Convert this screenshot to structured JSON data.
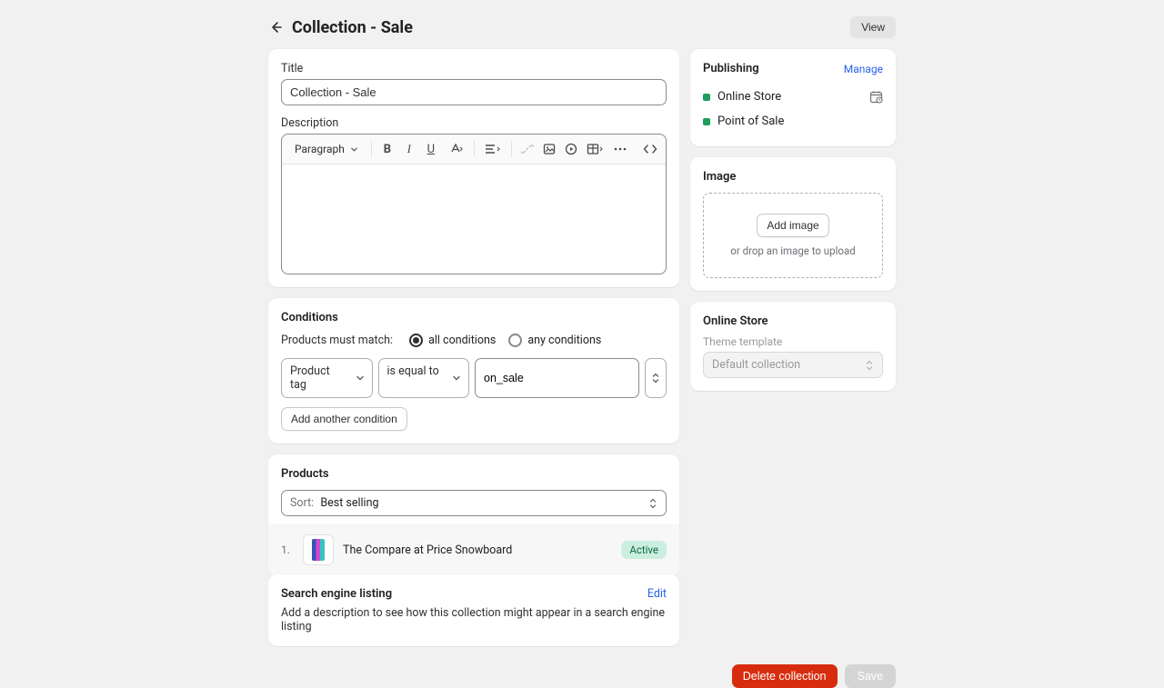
{
  "header": {
    "title": "Collection - Sale",
    "view_label": "View"
  },
  "title_section": {
    "label": "Title",
    "value": "Collection - Sale"
  },
  "description_section": {
    "label": "Description",
    "paragraph_label": "Paragraph"
  },
  "conditions": {
    "heading": "Conditions",
    "match_label": "Products must match:",
    "all_label": "all conditions",
    "any_label": "any conditions",
    "selected": "all",
    "field": "Product tag",
    "operator": "is equal to",
    "value": "on_sale",
    "add_label": "Add another condition"
  },
  "products": {
    "heading": "Products",
    "sort_prefix": "Sort:",
    "sort_value": "Best selling",
    "items": [
      {
        "index": "1.",
        "name": "The Compare at Price Snowboard",
        "status": "Active"
      }
    ]
  },
  "seo": {
    "heading": "Search engine listing",
    "edit_label": "Edit",
    "description": "Add a description to see how this collection might appear in a search engine listing"
  },
  "publishing": {
    "heading": "Publishing",
    "manage_label": "Manage",
    "channels": [
      {
        "name": "Online Store",
        "has_schedule": true
      },
      {
        "name": "Point of Sale",
        "has_schedule": false
      }
    ]
  },
  "image": {
    "heading": "Image",
    "add_label": "Add image",
    "hint": "or drop an image to upload"
  },
  "online_store": {
    "heading": "Online Store",
    "template_label": "Theme template",
    "template_value": "Default collection"
  },
  "footer": {
    "delete_label": "Delete collection",
    "save_label": "Save"
  }
}
